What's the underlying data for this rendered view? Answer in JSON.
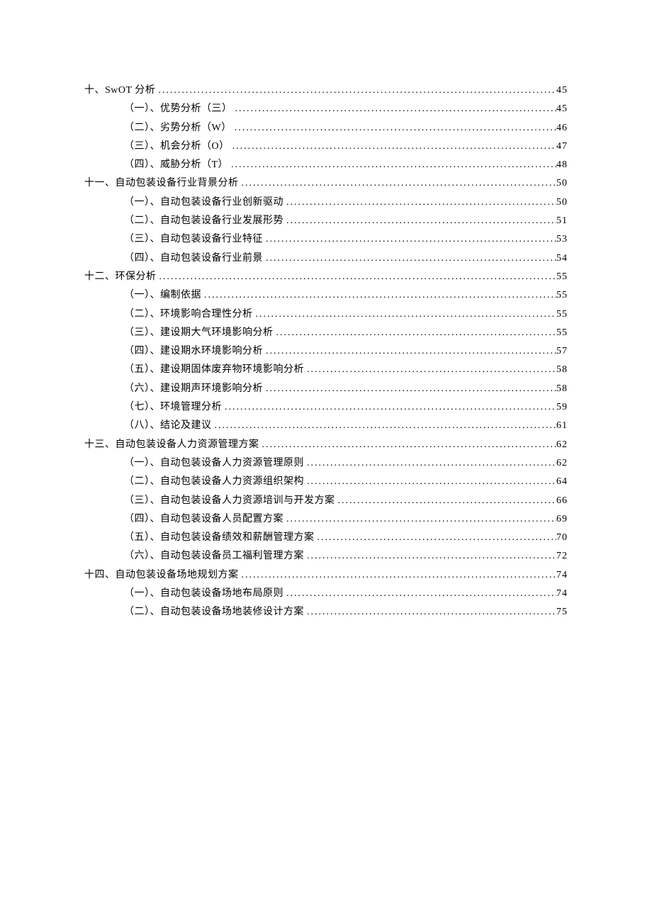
{
  "toc": [
    {
      "level": 0,
      "label": "十、SwOT 分析",
      "page": "45"
    },
    {
      "level": 1,
      "label": "（一）、优势分析（三）",
      "page": "45"
    },
    {
      "level": 1,
      "label": "（二）、劣势分析（W）",
      "page": "46"
    },
    {
      "level": 1,
      "label": "（三）、机会分析（O）",
      "page": "47"
    },
    {
      "level": 1,
      "label": "（四）、威胁分析（T）",
      "page": "48"
    },
    {
      "level": 0,
      "label": "十一、自动包装设备行业背景分析",
      "page": "50"
    },
    {
      "level": 1,
      "label": "（一）、自动包装设备行业创新驱动",
      "page": "50"
    },
    {
      "level": 1,
      "label": "（二）、自动包装设备行业发展形势",
      "page": "51"
    },
    {
      "level": 1,
      "label": "（三）、自动包装设备行业特征",
      "page": "53"
    },
    {
      "level": 1,
      "label": "（四）、自动包装设备行业前景",
      "page": "54"
    },
    {
      "level": 0,
      "label": "十二、环保分析",
      "page": "55"
    },
    {
      "level": 1,
      "label": "（一）、编制依据",
      "page": "55"
    },
    {
      "level": 1,
      "label": "（二）、环境影响合理性分析",
      "page": "55"
    },
    {
      "level": 1,
      "label": "（三）、建设期大气环境影响分析",
      "page": "55"
    },
    {
      "level": 1,
      "label": "（四）、建设期水环境影响分析",
      "page": "57"
    },
    {
      "level": 1,
      "label": "（五）、建设期固体废弃物环境影响分析",
      "page": "58"
    },
    {
      "level": 1,
      "label": "（六）、建设期声环境影响分析",
      "page": "58"
    },
    {
      "level": 1,
      "label": "（七）、环境管理分析",
      "page": "59"
    },
    {
      "level": 1,
      "label": "（八）、结论及建议",
      "page": "61"
    },
    {
      "level": 0,
      "label": "十三、自动包装设备人力资源管理方案",
      "page": "62"
    },
    {
      "level": 1,
      "label": "（一）、自动包装设备人力资源管理原则",
      "page": "62"
    },
    {
      "level": 1,
      "label": "（二）、自动包装设备人力资源组织架构",
      "page": "64"
    },
    {
      "level": 1,
      "label": "（三）、自动包装设备人力资源培训与开发方案",
      "page": "66"
    },
    {
      "level": 1,
      "label": "（四）、自动包装设备人员配置方案",
      "page": "69"
    },
    {
      "level": 1,
      "label": "（五）、自动包装设备绩效和薪酬管理方案",
      "page": "70"
    },
    {
      "level": 1,
      "label": "（六）、自动包装设备员工福利管理方案",
      "page": "72"
    },
    {
      "level": 0,
      "label": "十四、自动包装设备场地规划方案",
      "page": "74"
    },
    {
      "level": 1,
      "label": "（一）、自动包装设备场地布局原则",
      "page": "74"
    },
    {
      "level": 1,
      "label": "（二）、自动包装设备场地装修设计方案",
      "page": "75"
    }
  ]
}
